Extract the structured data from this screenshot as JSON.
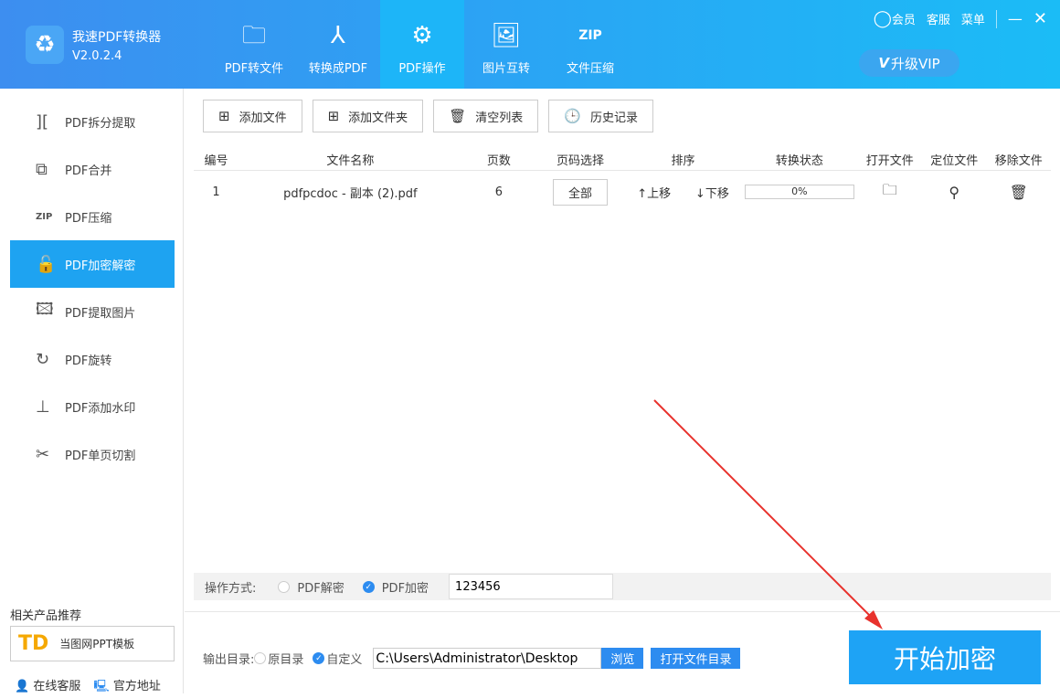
{
  "app": {
    "name": "我速PDF转换器",
    "version": "V2.0.2.4"
  },
  "nav": [
    {
      "label": "PDF转文件",
      "icon": "folder-icon"
    },
    {
      "label": "转换成PDF",
      "icon": "acrobat-icon"
    },
    {
      "label": "PDF操作",
      "icon": "gear-icon"
    },
    {
      "label": "图片互转",
      "icon": "image-icon"
    },
    {
      "label": "文件压缩",
      "icon": "zip-icon"
    }
  ],
  "top": {
    "member": "会员",
    "service": "客服",
    "menu": "菜单",
    "vip": "升级VIP"
  },
  "sidebar": {
    "items": [
      {
        "label": "PDF拆分提取"
      },
      {
        "label": "PDF合并"
      },
      {
        "label": "PDF压缩"
      },
      {
        "label": "PDF加密解密"
      },
      {
        "label": "PDF提取图片"
      },
      {
        "label": "PDF旋转"
      },
      {
        "label": "PDF添加水印"
      },
      {
        "label": "PDF单页切割"
      }
    ],
    "rec_title": "相关产品推荐",
    "rec_product": "当图网PPT模板",
    "online_service": "在线客服",
    "official_site": "官方地址"
  },
  "toolbar": {
    "add_file": "添加文件",
    "add_folder": "添加文件夹",
    "clear": "清空列表",
    "history": "历史记录"
  },
  "table": {
    "headers": [
      "编号",
      "文件名称",
      "页数",
      "页码选择",
      "排序",
      "转换状态",
      "打开文件",
      "定位文件",
      "移除文件"
    ],
    "rows": [
      {
        "no": "1",
        "name": "pdfpcdoc - 副本 (2).pdf",
        "pages": "6",
        "range": "全部",
        "up": "↑上移",
        "down": "↓下移",
        "progress": "0%"
      }
    ]
  },
  "options": {
    "label": "操作方式:",
    "decrypt": "PDF解密",
    "encrypt": "PDF加密",
    "password": "123456"
  },
  "output": {
    "label": "输出目录:",
    "original": "原目录",
    "custom": "自定义",
    "path": "C:\\Users\\Administrator\\Desktop",
    "browse": "浏览",
    "open_dir": "打开文件目录"
  },
  "start": "开始加密"
}
